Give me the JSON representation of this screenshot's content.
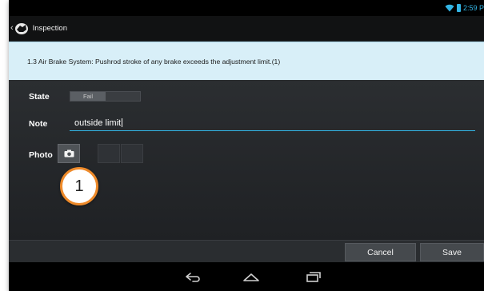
{
  "status_bar": {
    "time": "2:59 P"
  },
  "action_bar": {
    "title": "Inspection"
  },
  "question": {
    "text": "1.3 Air Brake System: Pushrod stroke of any brake exceeds the adjustment limit.(1)"
  },
  "form": {
    "state_label": "State",
    "state_value": "Fail",
    "note_label": "Note",
    "note_value": "outside limit",
    "photo_label": "Photo"
  },
  "callout": {
    "number": "1"
  },
  "buttons": {
    "cancel_label": "Cancel",
    "save_label": "Save"
  },
  "colors": {
    "accent": "#33b5e5",
    "callout_border": "#ee8a2a",
    "banner": "#d8eff8"
  },
  "icons": [
    "wifi-icon",
    "battery-icon",
    "app-icon",
    "camera-icon",
    "back-icon",
    "home-icon",
    "recents-icon"
  ]
}
